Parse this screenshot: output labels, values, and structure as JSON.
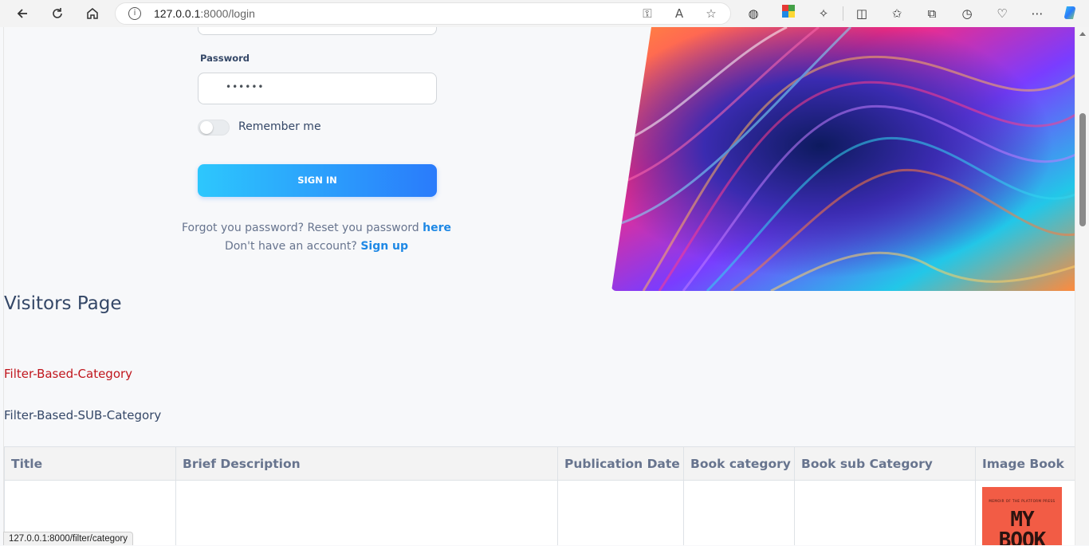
{
  "browser": {
    "url_host": "127.0.0.1",
    "url_path": ":8000/login",
    "status_url": "127.0.0.1:8000/filter/category"
  },
  "login": {
    "password_label": "Password",
    "password_value": "••••••",
    "remember_label": "Remember me",
    "remember_checked": false,
    "signin_label": "SIGN IN",
    "forgot_text": "Forgot you password? Reset you password ",
    "forgot_link": "here",
    "signup_text": "Don't have an account? ",
    "signup_link": "Sign up"
  },
  "visitors": {
    "heading": "Visitors Page",
    "filter_category": "Filter-Based-Category",
    "filter_sub_category": "Filter-Based-SUB-Category"
  },
  "table": {
    "headers": [
      "Title",
      "Brief Description",
      "Publication Date",
      "Book category",
      "Book sub Category",
      "Image Book"
    ]
  },
  "book_cover": {
    "kicker": "MEMOIR OF THE PLATFORM PRESS",
    "title": "MY BOOK"
  },
  "colors": {
    "accent_start": "#2dc7fd",
    "accent_end": "#2a7bfb",
    "link": "#1e88e5",
    "filter_category": "#c0161d",
    "heading": "#344767"
  }
}
